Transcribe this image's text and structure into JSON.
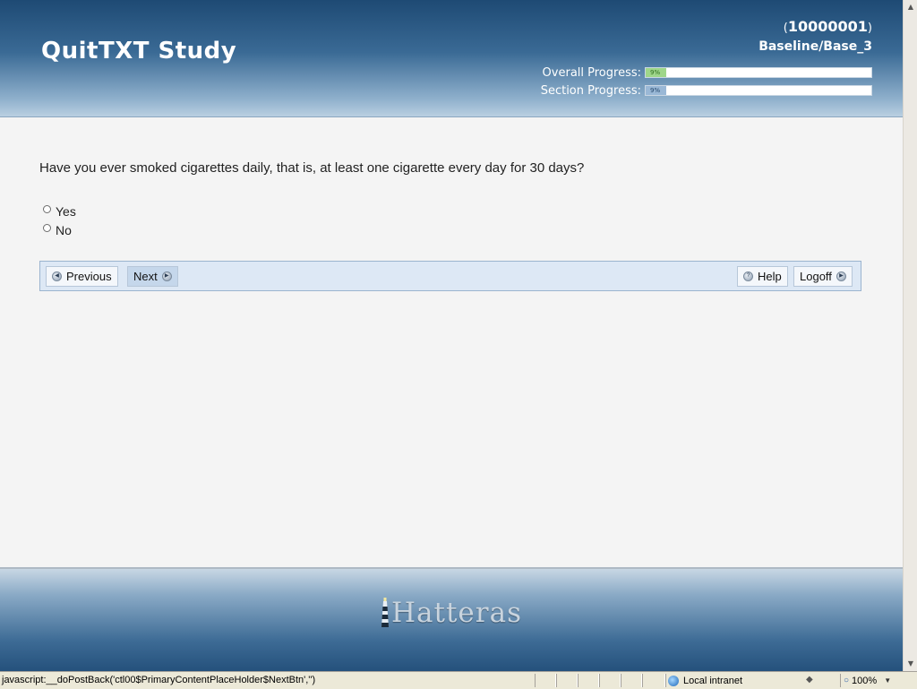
{
  "header": {
    "title": "QuitTXT Study",
    "user_id_open": "(",
    "user_id": "10000001",
    "user_id_close": ")",
    "section": "Baseline/Base_3",
    "overall_progress": {
      "label": "Overall Progress:",
      "text": "9%",
      "value": 9
    },
    "section_progress": {
      "label": "Section Progress:",
      "text": "9%",
      "value": 9
    }
  },
  "question": {
    "text": "Have you ever smoked cigarettes daily, that is, at least one cigarette every day for 30 days?",
    "options": [
      "Yes",
      "No"
    ]
  },
  "nav": {
    "previous": "Previous",
    "next": "Next",
    "help": "Help",
    "logoff": "Logoff"
  },
  "footer": {
    "brand": "Hatteras"
  },
  "statusbar": {
    "text": "javascript:__doPostBack('ctl00$PrimaryContentPlaceHolder$NextBtn','')",
    "zone": "Local intranet",
    "zoom": "100%"
  },
  "colors": {
    "header_dark": "#1e4a74",
    "overall_fill": "#9fd68a",
    "section_fill": "#9ab8d6",
    "nav_bar": "#dde8f5"
  },
  "icons": [
    "previous-icon",
    "next-icon",
    "help-icon",
    "logoff-icon",
    "lighthouse-icon",
    "globe-icon",
    "lock-icon",
    "zoom-icon"
  ]
}
